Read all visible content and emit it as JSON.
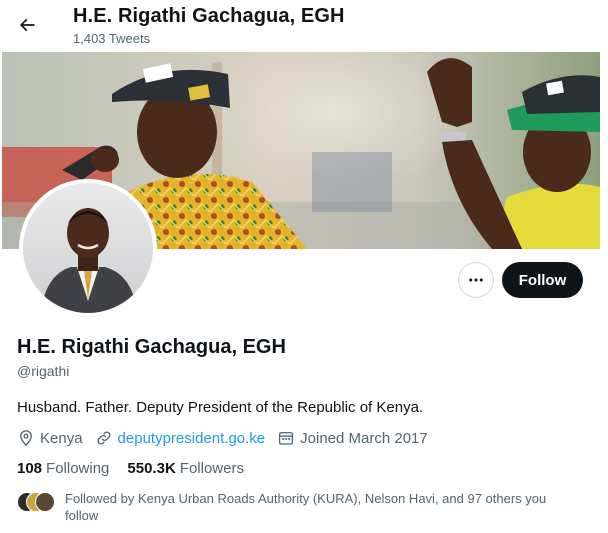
{
  "header": {
    "name": "H.E. Rigathi Gachagua, EGH",
    "tweet_count": "1,403 Tweets",
    "back_icon": "arrow-left-icon"
  },
  "actions": {
    "more_icon": "ellipsis-icon",
    "follow_label": "Follow"
  },
  "profile": {
    "display_name": "H.E. Rigathi Gachagua, EGH",
    "handle": "@rigathi",
    "bio": "Husband. Father. Deputy President of the Republic of Kenya.",
    "location": "Kenya",
    "location_icon": "location-pin-icon",
    "website": "deputypresident.go.ke",
    "website_icon": "link-icon",
    "joined": "Joined March 2017",
    "joined_icon": "calendar-icon"
  },
  "stats": {
    "following_count": "108",
    "following_label": "Following",
    "followers_count": "550.3K",
    "followers_label": "Followers"
  },
  "followed_by": {
    "text": "Followed by Kenya Urban Roads Authority (KURA), Nelson Havi, and 97 others you follow"
  },
  "colors": {
    "text_primary": "#0f1419",
    "text_secondary": "#536471",
    "link": "#1d9bf0",
    "follow_button_bg": "#0f1419"
  }
}
